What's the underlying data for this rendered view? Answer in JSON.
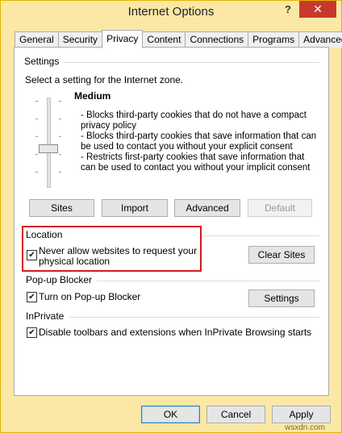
{
  "window": {
    "title": "Internet Options",
    "help": "?",
    "close": "✕"
  },
  "tabs": [
    "General",
    "Security",
    "Privacy",
    "Content",
    "Connections",
    "Programs",
    "Advanced"
  ],
  "active_tab": "Privacy",
  "settings": {
    "label": "Settings",
    "prompt": "Select a setting for the Internet zone.",
    "level": "Medium",
    "description": [
      "- Blocks third-party cookies that do not have a compact",
      "privacy policy",
      "- Blocks third-party cookies that save information that can",
      "be used to contact you without your explicit consent",
      "- Restricts first-party cookies that save information that",
      "can be used to contact you without your implicit consent"
    ],
    "buttons": {
      "sites": "Sites",
      "import": "Import",
      "advanced": "Advanced",
      "default": "Default"
    }
  },
  "location": {
    "label": "Location",
    "checkbox_line1": "Never allow websites to request your",
    "checkbox_line2": "physical location",
    "checked": true,
    "clear_sites": "Clear Sites"
  },
  "popup": {
    "label": "Pop-up Blocker",
    "checkbox": "Turn on Pop-up Blocker",
    "checked": true,
    "settings": "Settings"
  },
  "inprivate": {
    "label": "InPrivate",
    "checkbox": "Disable toolbars and extensions when InPrivate Browsing starts",
    "checked": true
  },
  "footer": {
    "ok": "OK",
    "cancel": "Cancel",
    "apply": "Apply"
  },
  "watermark": "wsxdn.com",
  "colors": {
    "frame": "#fbe8a6",
    "close": "#c7392d",
    "highlight": "#d71920"
  }
}
